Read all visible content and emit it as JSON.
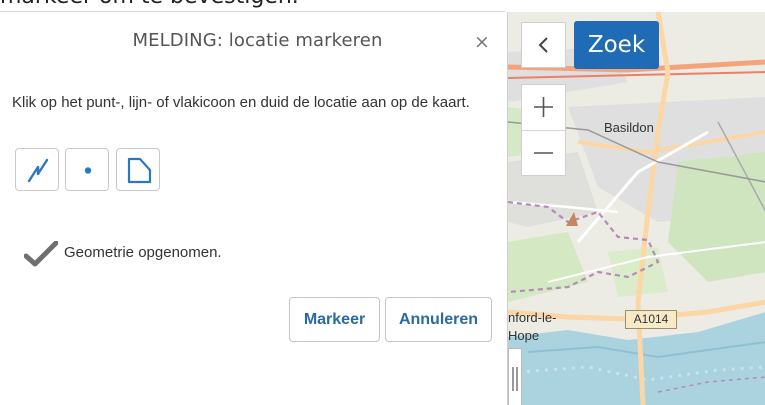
{
  "header": {
    "cut_text": "markeer om te bevestigen."
  },
  "dialog": {
    "title": "MELDING: locatie markeren",
    "close_symbol": "×",
    "instruction": "Klik op het punt-, lijn- of vlakicoon en duid de locatie aan op de kaart.",
    "tools": [
      {
        "name": "line",
        "icon": "line-draw-icon"
      },
      {
        "name": "point",
        "icon": "point-draw-icon"
      },
      {
        "name": "polygon",
        "icon": "polygon-draw-icon"
      }
    ],
    "status": {
      "icon": "checkmark-icon",
      "text": "Geometrie opgenomen."
    },
    "buttons": {
      "confirm": "Markeer",
      "cancel": "Annuleren"
    },
    "accent_color": "#2a6aa3"
  },
  "map": {
    "search_label": "Zoek",
    "collapse_icon": "chevron-left-icon",
    "zoom_in_icon": "plus-icon",
    "zoom_out_icon": "minus-icon",
    "labels": {
      "town1": "Basildon",
      "town2a": "nford-le-",
      "town2b": "Hope"
    },
    "road_shield": "A1014",
    "search_color": "#1f6bb5"
  }
}
